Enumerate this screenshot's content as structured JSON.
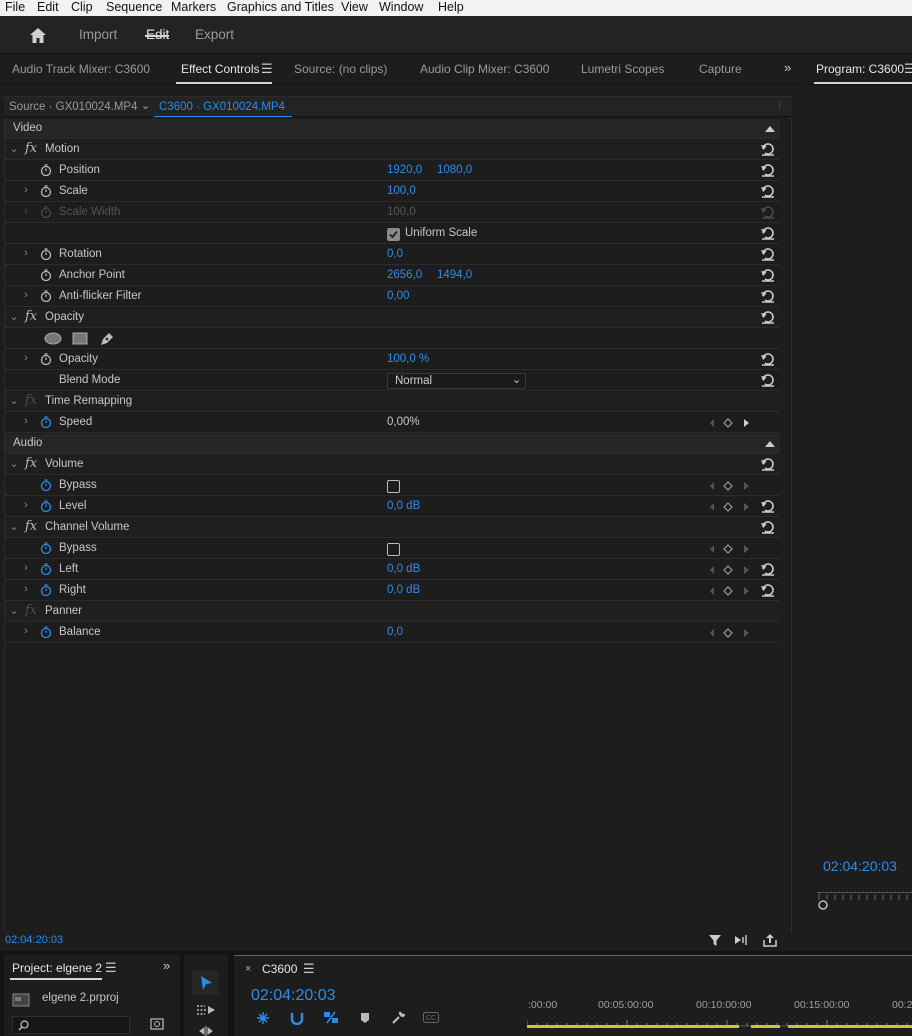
{
  "menu": [
    "File",
    "Edit",
    "Clip",
    "Sequence",
    "Markers",
    "Graphics and Titles",
    "View",
    "Window",
    "Help"
  ],
  "workspaces": {
    "import": "Import",
    "edit": "Edit",
    "export": "Export"
  },
  "tabs": {
    "audio_track_mixer": "Audio Track Mixer: C3600",
    "effect_controls": "Effect Controls",
    "source": "Source: (no clips)",
    "audio_clip_mixer": "Audio Clip Mixer: C3600",
    "lumetri": "Lumetri Scopes",
    "capture": "Capture",
    "program": "Program: C3600"
  },
  "clip": {
    "source": "Source · GX010024.MP4",
    "sequence": "C3600 · GX010024.MP4"
  },
  "video": {
    "section": "Video",
    "motion": "Motion",
    "position": {
      "label": "Position",
      "x": "1920,0",
      "y": "1080,0"
    },
    "scale": {
      "label": "Scale",
      "value": "100,0"
    },
    "scale_width": {
      "label": "Scale Width",
      "value": "100,0"
    },
    "uniform_scale": "Uniform Scale",
    "rotation": {
      "label": "Rotation",
      "value": "0,0"
    },
    "anchor": {
      "label": "Anchor Point",
      "x": "2656,0",
      "y": "1494,0"
    },
    "antiflicker": {
      "label": "Anti-flicker Filter",
      "value": "0,00"
    },
    "opacity_group": "Opacity",
    "opacity": {
      "label": "Opacity",
      "value": "100,0 %"
    },
    "blend": {
      "label": "Blend Mode",
      "value": "Normal"
    },
    "time_remap": "Time Remapping",
    "speed": {
      "label": "Speed",
      "value": "0,00%"
    }
  },
  "audio": {
    "section": "Audio",
    "volume": "Volume",
    "bypass": "Bypass",
    "level": {
      "label": "Level",
      "value": "0,0 dB"
    },
    "channel_volume": "Channel Volume",
    "left": {
      "label": "Left",
      "value": "0,0 dB"
    },
    "right": {
      "label": "Right",
      "value": "0,0 dB"
    },
    "panner": "Panner",
    "balance": {
      "label": "Balance",
      "value": "0,0"
    }
  },
  "status_time": "02:04:20:03",
  "program_time": "02:04:20:03",
  "project": {
    "tab": "Project: elgene 2",
    "file": "elgene 2.prproj"
  },
  "timeline": {
    "sequence": "C3600",
    "time": "02:04:20:03",
    "ruler": [
      ":00:00",
      "00:05:00:00",
      "00:10:00:00",
      "00:15:00:00",
      "00:2"
    ]
  },
  "colors": {
    "accent": "#2d8ceb",
    "panel": "#1d1d1d"
  }
}
